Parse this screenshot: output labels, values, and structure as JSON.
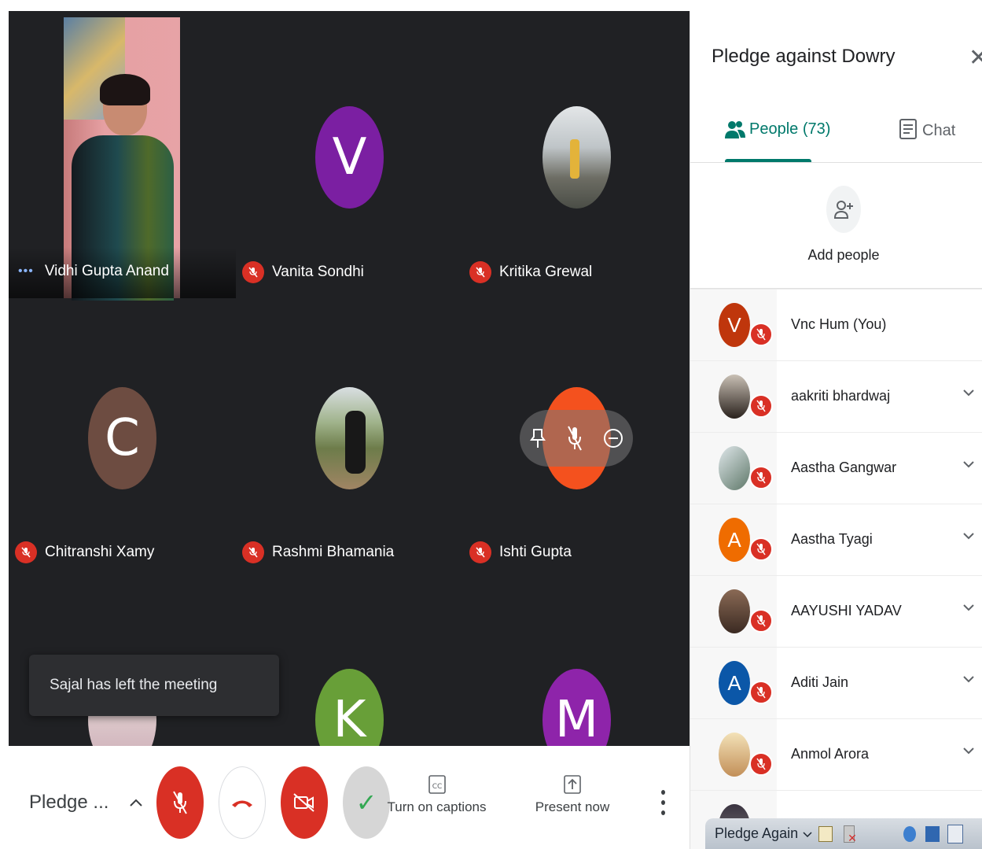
{
  "meeting": {
    "title_short": "Pledge ...",
    "panel_title": "Pledge against Dowry"
  },
  "tiles": [
    {
      "name": "Vidhi Gupta Anand",
      "kind": "video"
    },
    {
      "name": "Vanita Sondhi",
      "initial": "V",
      "color": "#7b1fa2"
    },
    {
      "name": "Kritika Grewal",
      "kind": "photo"
    },
    {
      "name": "Chitranshi Xamy",
      "initial": "C",
      "color": "#6d4c41"
    },
    {
      "name": "Rashmi Bhamania",
      "kind": "photo"
    },
    {
      "name": "Ishti Gupta",
      "kind": "hover"
    },
    {
      "initial": "K",
      "color": "#689f38"
    },
    {
      "initial": "M",
      "color": "#8e24aa"
    }
  ],
  "toast": "Sajal has left the meeting",
  "controls": {
    "captions": "Turn on captions",
    "present": "Present now"
  },
  "panel": {
    "tab_people": "People (73)",
    "tab_chat": "Chat",
    "add_people": "Add people",
    "participants": [
      {
        "name": "Vnc Hum (You)",
        "initial": "V",
        "color": "#bf360c",
        "type": "initial"
      },
      {
        "name": "aakriti bhardwaj",
        "type": "photo",
        "color": "#3a2f2a"
      },
      {
        "name": "Aastha Gangwar",
        "type": "photo",
        "color": "#7a8d80"
      },
      {
        "name": "Aastha Tyagi",
        "initial": "A",
        "color": "#ef6c00",
        "type": "initial"
      },
      {
        "name": "AAYUSHI YADAV",
        "type": "photo",
        "color": "#6b4a3a"
      },
      {
        "name": "Aditi Jain",
        "initial": "A",
        "color": "#0b57a8",
        "type": "initial"
      },
      {
        "name": "Anmol Arora",
        "type": "photo",
        "color": "#c9a66b"
      }
    ]
  },
  "taskbar": {
    "label": "Pledge Again"
  }
}
